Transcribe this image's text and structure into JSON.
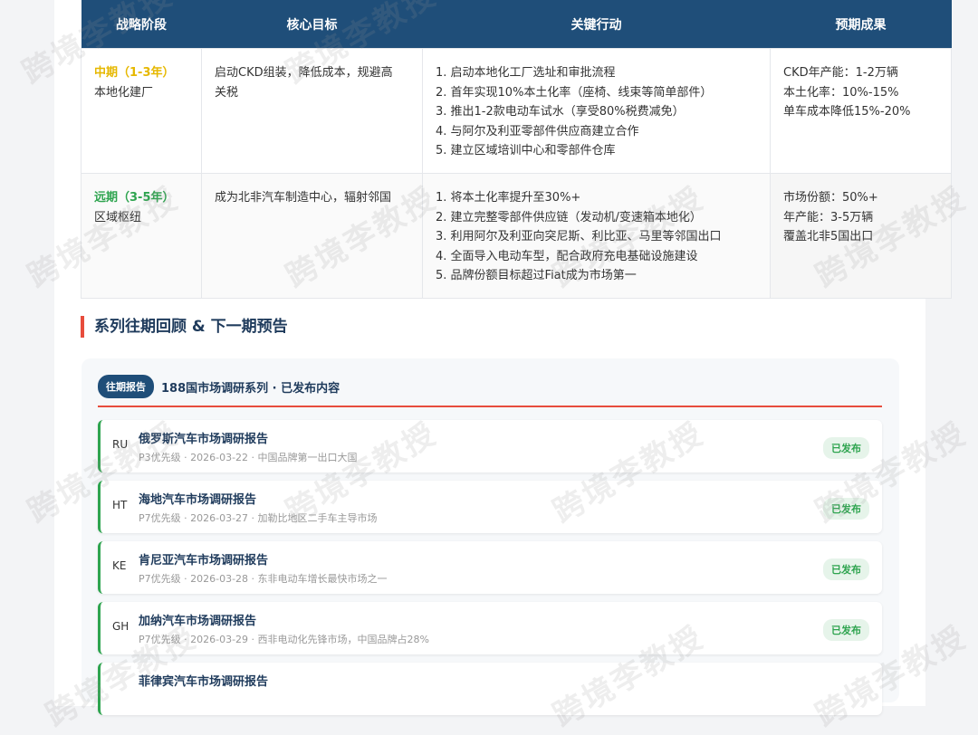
{
  "table": {
    "headers": [
      "战略阶段",
      "核心目标",
      "关键行动",
      "预期成果"
    ],
    "rows": [
      {
        "phase_tag": "中期（1-3年）",
        "phase_name": "本地化建厂",
        "goal_lines": [
          "启动CKD组装，降低成本，规避高",
          "关税"
        ],
        "actions": [
          "1. 启动本地化工厂选址和审批流程",
          "2. 首年实现10%本土化率（座椅、线束等简单部件）",
          "3. 推出1-2款电动车试水（享受80%税费减免）",
          "4. 与阿尔及利亚零部件供应商建立合作",
          "5. 建立区域培训中心和零部件仓库"
        ],
        "results": [
          "CKD年产能：1-2万辆",
          "本土化率：10%-15%",
          "单车成本降低15%-20%"
        ]
      },
      {
        "phase_tag": "远期（3-5年）",
        "phase_name": "区域枢纽",
        "goal_lines": [
          "成为北非汽车制造中心，辐射邻国"
        ],
        "actions": [
          "1. 将本土化率提升至30%+",
          "2. 建立完整零部件供应链（发动机/变速箱本地化）",
          "3. 利用阿尔及利亚向突尼斯、利比亚、马里等邻国出口",
          "4. 全面导入电动车型，配合政府充电基础设施建设",
          "5. 品牌份额目标超过Fiat成为市场第一"
        ],
        "results": [
          "市场份额：50%+",
          "年产能：3-5万辆",
          "覆盖北非5国出口"
        ]
      }
    ]
  },
  "section": {
    "heading": "系列往期回顾 & 下一期预告"
  },
  "series": {
    "badge": "往期报告",
    "title": "188国市场调研系列 · 已发布内容",
    "items": [
      {
        "code": "RU",
        "title": "俄罗斯汽车市场调研报告",
        "meta": "P3优先级 · 2026-03-22 · 中国品牌第一出口大国",
        "status": "已发布"
      },
      {
        "code": "HT",
        "title": "海地汽车市场调研报告",
        "meta": "P7优先级 · 2026-03-27 · 加勒比地区二手车主导市场",
        "status": "已发布"
      },
      {
        "code": "KE",
        "title": "肯尼亚汽车市场调研报告",
        "meta": "P7优先级 · 2026-03-28 · 东非电动车增长最快市场之一",
        "status": "已发布"
      },
      {
        "code": "GH",
        "title": "加纳汽车市场调研报告",
        "meta": "P7优先级 · 2026-03-29 · 西非电动化先锋市场，中国品牌占28%",
        "status": "已发布"
      },
      {
        "code": "",
        "title": "菲律宾汽车市场调研报告",
        "meta": "",
        "status": ""
      }
    ]
  },
  "watermark": "跨境李教授",
  "colors": {
    "header_bg": "#1f4e79",
    "accent_red": "#e74c3c",
    "mid_phase": "#e6b800",
    "long_phase": "#2ea44f",
    "published_green": "#2ea44f"
  }
}
